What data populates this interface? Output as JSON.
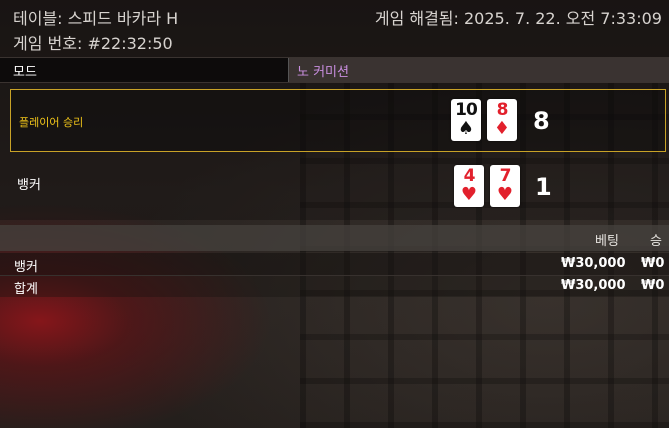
{
  "header": {
    "table": "테이블: 스피드 바카라 H",
    "round": "게임 번호: #22:32:50",
    "settled": "게임 해결됨: 2025. 7. 22. 오전 7:33:09"
  },
  "mode": {
    "label": "모드",
    "value": "노 커미션"
  },
  "player": {
    "label": "플레이어 승리",
    "score": "8",
    "cards": [
      {
        "rank": "10",
        "suit": "♠",
        "color": "#111111"
      },
      {
        "rank": "8",
        "suit": "♦",
        "color": "#e2202c"
      }
    ]
  },
  "banker": {
    "label": "뱅커",
    "score": "1",
    "cards": [
      {
        "rank": "4",
        "suit": "♥",
        "color": "#e2202c"
      },
      {
        "rank": "7",
        "suit": "♥",
        "color": "#e2202c"
      }
    ]
  },
  "bets": {
    "columns": {
      "bet": "베팅",
      "win": "승"
    },
    "rows": [
      {
        "name": "뱅커",
        "bet": "₩30,000",
        "win": "₩0"
      },
      {
        "name": "합계",
        "bet": "₩30,000",
        "win": "₩0"
      }
    ]
  },
  "colors": {
    "winner_border": "#c8a227",
    "winner_text": "#f0c419",
    "mode_value": "#c98fe0"
  }
}
